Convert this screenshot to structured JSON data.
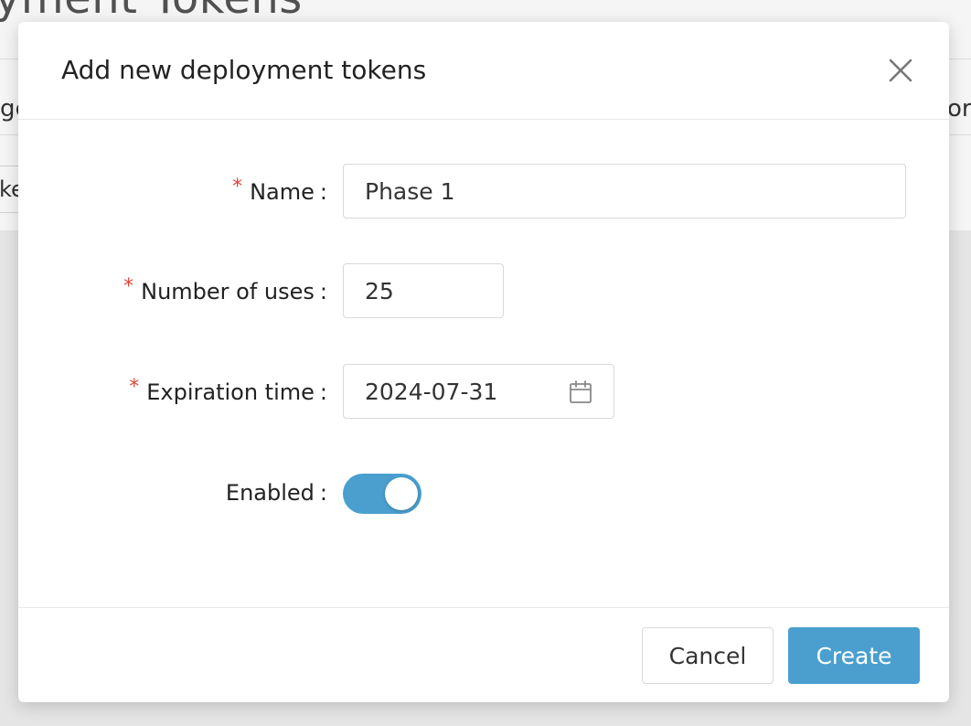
{
  "background": {
    "page_title_fragment": "yment Tokens",
    "left_fragment_1": "ge",
    "right_fragment_1": "or",
    "left_fragment_2": "ke"
  },
  "modal": {
    "title": "Add new deployment tokens",
    "close_icon": "close-icon",
    "fields": {
      "name": {
        "label": "Name",
        "value": "Phase 1",
        "required": true
      },
      "uses": {
        "label": "Number of uses",
        "value": "25",
        "required": true
      },
      "expiration": {
        "label": "Expiration time",
        "value": "2024-07-31",
        "required": true,
        "icon": "calendar-icon"
      },
      "enabled": {
        "label": "Enabled",
        "checked": true
      }
    },
    "required_marker": "*",
    "colon": ":",
    "footer": {
      "cancel_label": "Cancel",
      "create_label": "Create"
    }
  },
  "colors": {
    "accent": "#4a9fcf",
    "required": "#e0463c"
  }
}
